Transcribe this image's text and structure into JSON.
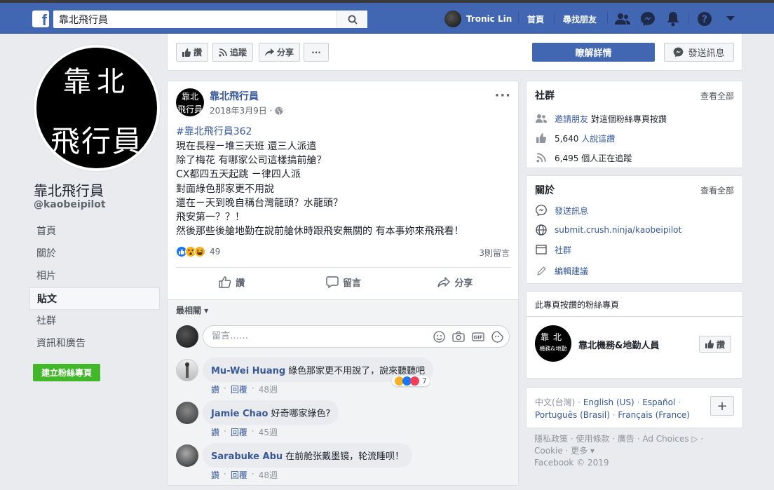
{
  "topbar": {
    "search_value": "靠北飛行員",
    "user_name": "Tronic Lin",
    "nav": [
      "首頁",
      "尋找朋友"
    ]
  },
  "page": {
    "name": "靠北飛行員",
    "handle": "@kaobeipilot",
    "pic_line1": "靠北",
    "pic_line2": "飛行員",
    "side_nav": [
      "首頁",
      "關於",
      "相片",
      "貼文",
      "社群",
      "資訊和廣告"
    ],
    "active_nav": "貼文",
    "create_button": "建立粉絲專頁"
  },
  "action_bar": {
    "like": "讚",
    "follow": "追蹤",
    "share": "分享",
    "more": "···",
    "learn_more": "瞭解詳情",
    "send_message": "發送訊息"
  },
  "post": {
    "author": "靠北飛行員",
    "avatar_text_1": "靠北",
    "avatar_text_2": "飛行員",
    "date": "2018年3月9日 ·",
    "hashtag": "#靠北飛行員362",
    "body": "現在長程ㄧ堆三天班 還三人派遣\n除了梅花 有哪家公司這樣搞前艙？\nCX都四五天起跳 ㄧ律四人派\n對面綠色那家更不用說\n還在ㄧ天到晚自稱台灣龍頭？水龍頭？\n飛安第一？？！\n然後那些後艙地勤在說前艙休時跟飛安無關的 有本事妳來飛飛看！",
    "reaction_count": "49",
    "comment_count": "3則留言",
    "actions": [
      "讚",
      "留言",
      "分享"
    ],
    "sort_label": "最相關 ▾",
    "comment_placeholder": "留言……"
  },
  "comments": [
    {
      "author": "Mu-Wei Huang",
      "text": "綠色那家更不用說了，說來聽聽吧",
      "like": "讚",
      "reply": "回覆",
      "time": "48週",
      "reactions": "7"
    },
    {
      "author": "Jamie Chao",
      "text": "好奇哪家綠色?",
      "like": "讚",
      "reply": "回覆",
      "time": "45週"
    },
    {
      "author": "Sarabuke Abu",
      "text": "在前舱张戴墨镜，轮流睡呗！",
      "like": "讚",
      "reply": "回覆",
      "time": "48週"
    }
  ],
  "community": {
    "title": "社群",
    "see_all": "查看全部",
    "invite_link": "邀請朋友",
    "invite_rest": "對這個粉絲專頁按讚",
    "likes_num": "5,640",
    "likes_rest": "人說這讚",
    "follows_num": "6,495",
    "follows_rest": "個人正在追蹤"
  },
  "about": {
    "title": "關於",
    "see_all": "查看全部",
    "message": "發送訊息",
    "website": "submit.crush.ninja/kaobeipilot",
    "category": "社群",
    "edit": "編輯建議"
  },
  "liked_pages": {
    "title": "此專頁按讚的粉絲專頁",
    "name": "靠北機務&地勤人員",
    "avatar_1": "靠北",
    "avatar_2": "機務&地勤",
    "like": "讚"
  },
  "languages": {
    "current": "中文(台灣)",
    "others": [
      "English (US)",
      "Español",
      "Português (Brasil)",
      "Français (France)"
    ],
    "add": "+"
  },
  "footer": {
    "line1": "隱私政策 · 使用條款 · 廣告 · Ad Choices ▷ ·",
    "line2": "Cookie · 更多 ▾",
    "line3": "Facebook © 2019"
  },
  "colors": {
    "brand": "#4267b2",
    "link": "#365899",
    "create_green": "#42b72a"
  }
}
